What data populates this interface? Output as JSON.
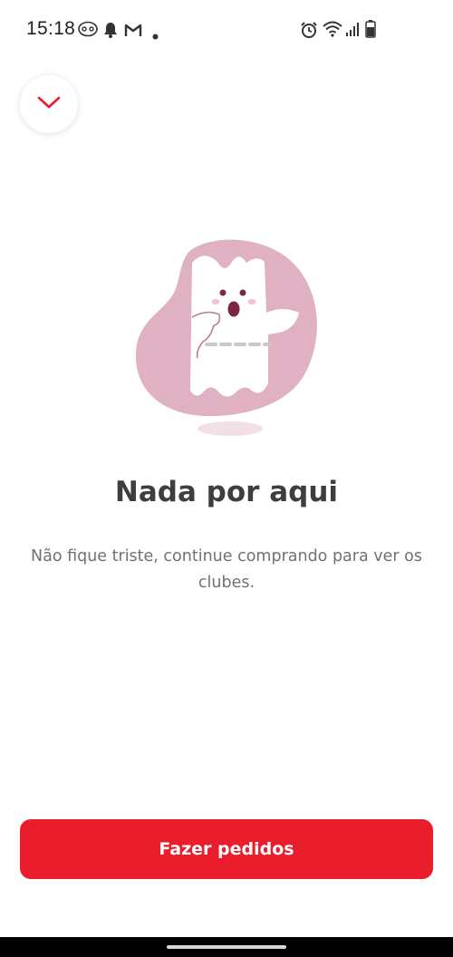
{
  "status_bar": {
    "time": "15:18",
    "left_icons": [
      "game-controller-icon",
      "bell-icon",
      "gmail-icon",
      "dot-icon"
    ],
    "right_icons": [
      "alarm-icon",
      "wifi-icon",
      "signal-icon",
      "battery-icon"
    ]
  },
  "header": {
    "collapse_icon": "chevron-down-icon",
    "accent_color": "#ea1d2c"
  },
  "empty_state": {
    "title": "Nada por aqui",
    "description": "Não fique triste, continue comprando para ver os clubes.",
    "illustration": "ghost-ticket-icon"
  },
  "footer": {
    "button_label": "Fazer pedidos",
    "button_color": "#ea1d2c"
  }
}
